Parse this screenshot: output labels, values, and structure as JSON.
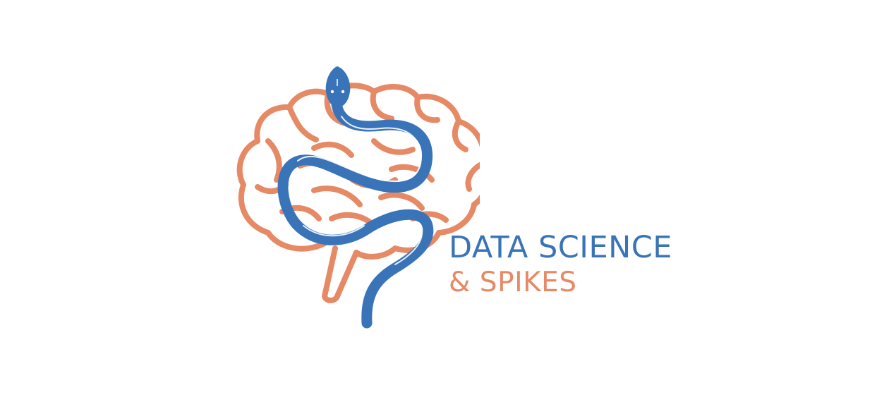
{
  "logo": {
    "line1": "DATA SCIENCE",
    "line2": "& SPIKES",
    "brain_icon": "brain-icon",
    "snake_icon": "snake-icon"
  },
  "colors": {
    "blue": "#3974B8",
    "orange": "#E68965",
    "background": "#FFFFFF"
  }
}
